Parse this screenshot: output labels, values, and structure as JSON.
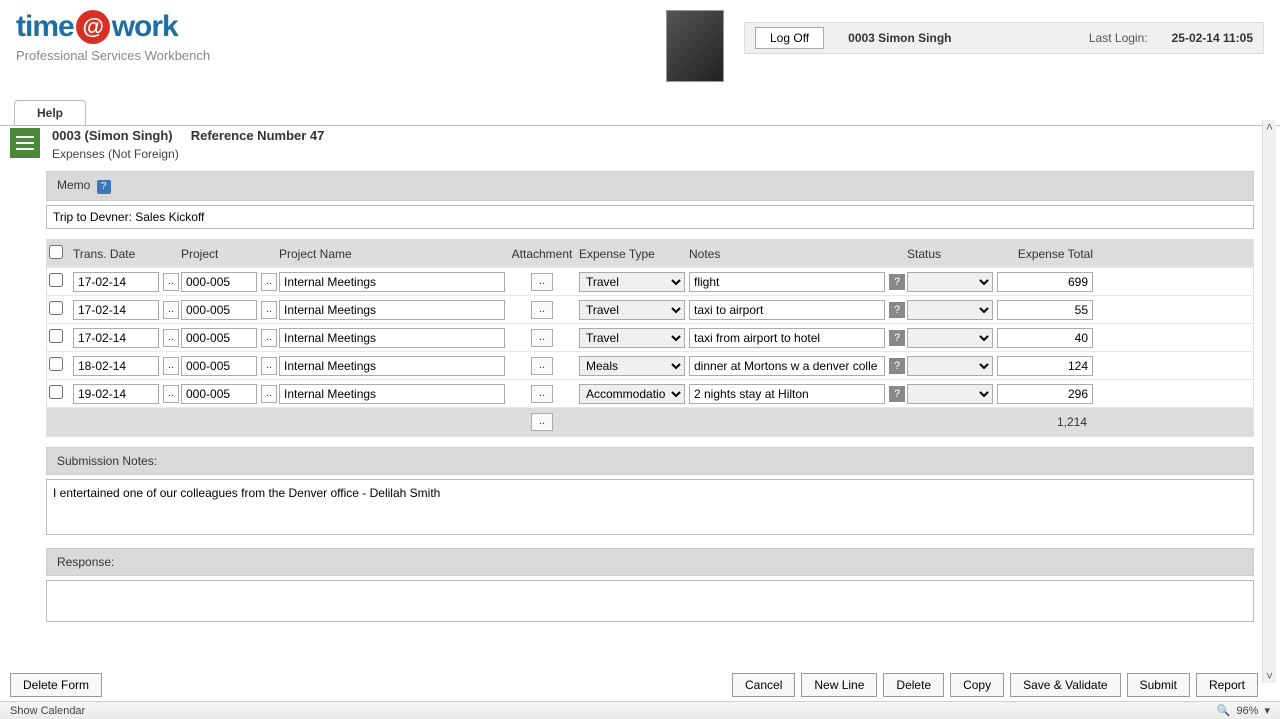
{
  "logo": {
    "part1": "time",
    "at": "@",
    "part2": "work",
    "sub": "Professional Services Workbench"
  },
  "header": {
    "logoff": "Log Off",
    "user": "0003 Simon Singh",
    "last_login_label": "Last Login:",
    "last_login_value": "25-02-14 11:05"
  },
  "help_tab": "Help",
  "title": {
    "line1_a": "0003 (Simon Singh)",
    "line1_b": "Reference Number 47",
    "line2": "Expenses (Not Foreign)"
  },
  "memo": {
    "label": "Memo",
    "value": "Trip to Devner: Sales Kickoff"
  },
  "columns": {
    "trans_date": "Trans. Date",
    "project": "Project",
    "project_name": "Project Name",
    "attachment": "Attachment",
    "expense_type": "Expense Type",
    "notes": "Notes",
    "status": "Status",
    "expense_total": "Expense Total"
  },
  "expense_types": [
    "Travel",
    "Meals",
    "Accommodation"
  ],
  "rows": [
    {
      "date": "17-02-14",
      "proj": "000-005",
      "pname": "Internal Meetings",
      "type": "Travel",
      "notes": "flight",
      "total": "699"
    },
    {
      "date": "17-02-14",
      "proj": "000-005",
      "pname": "Internal Meetings",
      "type": "Travel",
      "notes": "taxi to airport",
      "total": "55"
    },
    {
      "date": "17-02-14",
      "proj": "000-005",
      "pname": "Internal Meetings",
      "type": "Travel",
      "notes": "taxi from airport to hotel",
      "total": "40"
    },
    {
      "date": "18-02-14",
      "proj": "000-005",
      "pname": "Internal Meetings",
      "type": "Meals",
      "notes": "dinner at Mortons w a denver colle",
      "total": "124"
    },
    {
      "date": "19-02-14",
      "proj": "000-005",
      "pname": "Internal Meetings",
      "type": "Accommodation",
      "notes": "2 nights stay at Hilton",
      "total": "296"
    }
  ],
  "grand_total": "1,214",
  "submission": {
    "label": "Submission Notes:",
    "value": "I entertained one of our colleagues from the Denver office - Delilah Smith"
  },
  "response": {
    "label": "Response:"
  },
  "footer": {
    "delete_form": "Delete Form",
    "cancel": "Cancel",
    "new_line": "New Line",
    "delete": "Delete",
    "copy": "Copy",
    "save_validate": "Save & Validate",
    "submit": "Submit",
    "report": "Report"
  },
  "status_bar": {
    "left": "Show Calendar",
    "zoom": "96%"
  }
}
